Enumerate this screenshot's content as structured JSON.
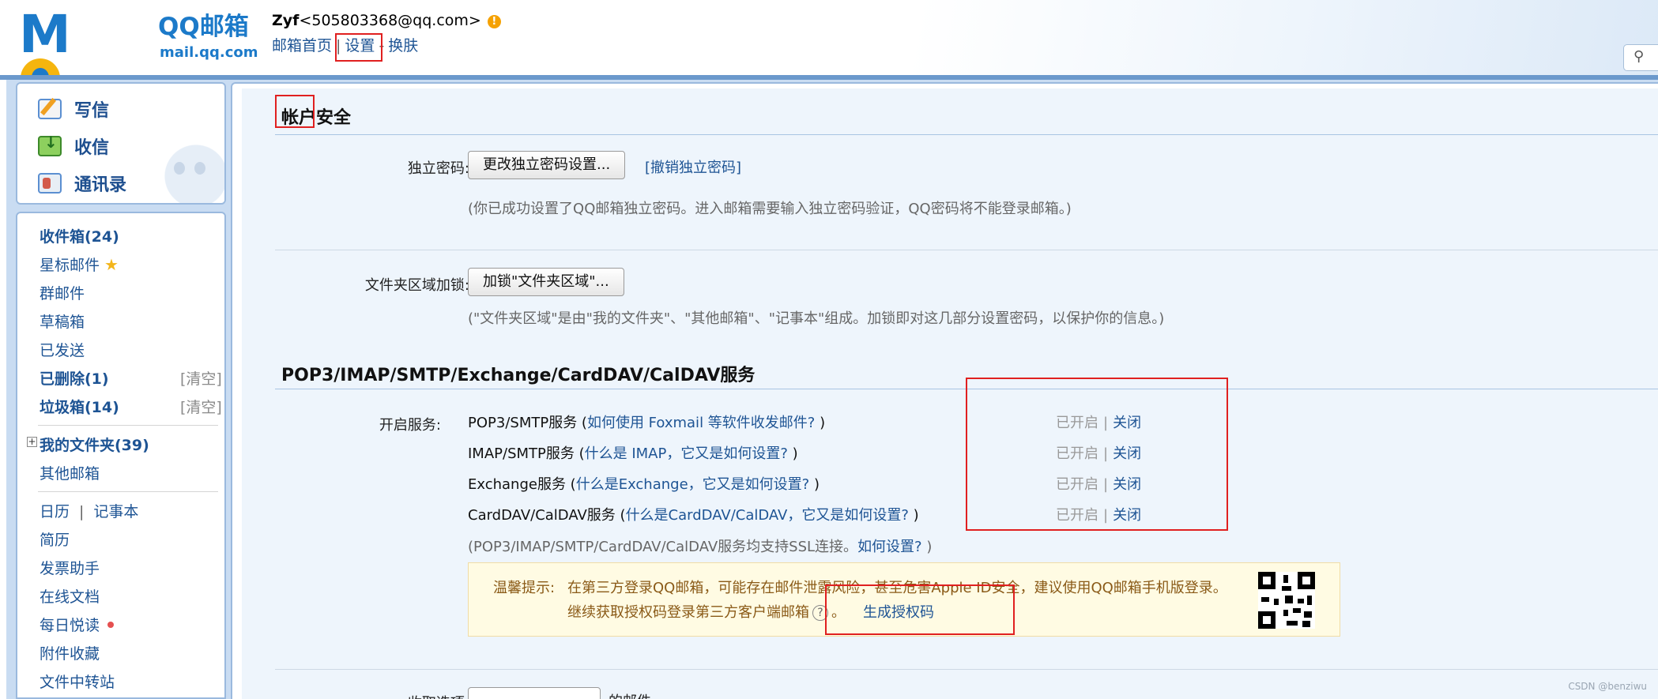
{
  "header": {
    "logo_brand": "QQ邮箱",
    "logo_domain": "mail.qq.com",
    "user_name": "Zyf",
    "user_email": "<505803368@qq.com>",
    "nav": {
      "home": "邮箱首页",
      "separator": "|",
      "settings": "设置",
      "dash": "-",
      "skin": "换肤"
    }
  },
  "sidebar": {
    "quick": {
      "write": "写信",
      "inbox": "收信",
      "contacts": "通讯录"
    },
    "folders": {
      "inbox": "收件箱(24)",
      "starred": "星标邮件",
      "group": "群邮件",
      "drafts": "草稿箱",
      "sent": "已发送",
      "deleted": "已删除(1)",
      "spam": "垃圾箱(14)",
      "clear": "[清空]",
      "my_folders": "我的文件夹(39)",
      "other_mailbox": "其他邮箱"
    },
    "tools": {
      "calendar": "日历",
      "tool_sep": "|",
      "notepad": "记事本",
      "resume": "简历",
      "invoice": "发票助手",
      "docs": "在线文档",
      "daily_read": "每日悦读",
      "attachments": "附件收藏",
      "transfer": "文件中转站"
    }
  },
  "main": {
    "account_security": {
      "title": "帐户安全",
      "independent_pwd_label": "独立密码:",
      "change_pwd_button": "更改独立密码设置...",
      "cancel_pwd_link": "[撤销独立密码]",
      "pwd_hint": "(你已成功设置了QQ邮箱独立密码。进入邮箱需要输入独立密码验证，QQ密码将不能登录邮箱。)",
      "folder_lock_label": "文件夹区域加锁:",
      "folder_lock_button": "加锁\"文件夹区域\"...",
      "folder_lock_hint": "(\"文件夹区域\"是由\"我的文件夹\"、\"其他邮箱\"、\"记事本\"组成。加锁即对这几部分设置密码，以保护你的信息。)"
    },
    "services": {
      "title": "POP3/IMAP/SMTP/Exchange/CardDAV/CalDAV服务",
      "open_label": "开启服务:",
      "items": [
        {
          "name": "POP3/SMTP服务 (",
          "link": "如何使用 Foxmail 等软件收发邮件?",
          "end": " )",
          "status": "已开启",
          "sep": "|",
          "action": "关闭"
        },
        {
          "name": "IMAP/SMTP服务 (",
          "link": "什么是 IMAP，它又是如何设置?",
          "end": " )",
          "status": "已开启",
          "sep": "|",
          "action": "关闭"
        },
        {
          "name": "Exchange服务 (",
          "link": "什么是Exchange，它又是如何设置?",
          "end": " )",
          "status": "已开启",
          "sep": "|",
          "action": "关闭"
        },
        {
          "name": "CardDAV/CalDAV服务 (",
          "link": "什么是CardDAV/CalDAV，它又是如何设置?",
          "end": " )",
          "status": "已开启",
          "sep": "|",
          "action": "关闭"
        }
      ],
      "ssl_hint_prefix": "(POP3/IMAP/SMTP/CardDAV/CalDAV服务均支持SSL连接。",
      "ssl_hint_link": "如何设置?",
      "ssl_hint_suffix": " )",
      "tip_label": "温馨提示:",
      "tip_line1": "在第三方登录QQ邮箱，可能存在邮件泄露风险，甚至危害Apple ID安全，建议使用QQ邮箱手机版登录。",
      "tip_line2": "继续获取授权码登录第三方客户端邮箱",
      "tip_period": "。",
      "generate_code": "生成授权码"
    },
    "partial_next_label": "收取选项:",
    "partial_next_suffix": "的邮件"
  },
  "watermark": "CSDN @benziwu",
  "colors": {
    "link": "#1e5494",
    "annotation_box": "#e02020",
    "tip_bg": "#fffbe3"
  }
}
